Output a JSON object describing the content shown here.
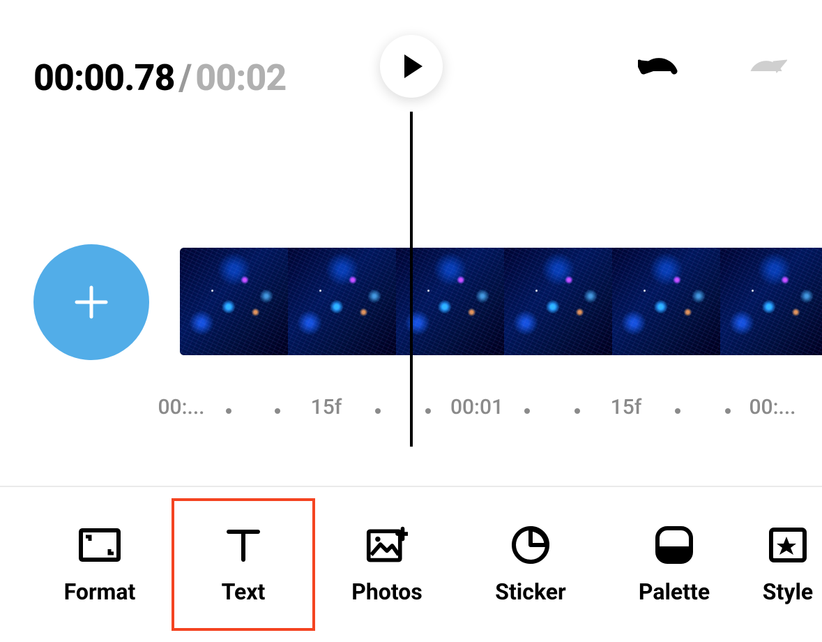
{
  "playback": {
    "current_time": "00:00.78",
    "separator": "/",
    "total_time": "00:02"
  },
  "timeline": {
    "ruler": [
      {
        "pos": 260,
        "label": "00:..."
      },
      {
        "pos": 328,
        "dot": true
      },
      {
        "pos": 398,
        "dot": true
      },
      {
        "pos": 468,
        "label": "15f"
      },
      {
        "pos": 542,
        "dot": true
      },
      {
        "pos": 614,
        "dot": true
      },
      {
        "pos": 684,
        "label": "00:01"
      },
      {
        "pos": 756,
        "dot": true
      },
      {
        "pos": 828,
        "dot": true
      },
      {
        "pos": 898,
        "label": "15f"
      },
      {
        "pos": 972,
        "dot": true
      },
      {
        "pos": 1044,
        "dot": true
      },
      {
        "pos": 1108,
        "label": "00:..."
      }
    ],
    "clip_frame_count": 6
  },
  "toolbar": {
    "items": [
      {
        "id": "format",
        "label": "Format",
        "icon": "format-icon",
        "selected": false
      },
      {
        "id": "text",
        "label": "Text",
        "icon": "text-icon",
        "selected": true
      },
      {
        "id": "photos",
        "label": "Photos",
        "icon": "photos-icon",
        "selected": false
      },
      {
        "id": "sticker",
        "label": "Sticker",
        "icon": "sticker-icon",
        "selected": false
      },
      {
        "id": "palette",
        "label": "Palette",
        "icon": "palette-icon",
        "selected": false
      },
      {
        "id": "style",
        "label": "Style",
        "icon": "style-icon",
        "selected": false
      }
    ]
  }
}
